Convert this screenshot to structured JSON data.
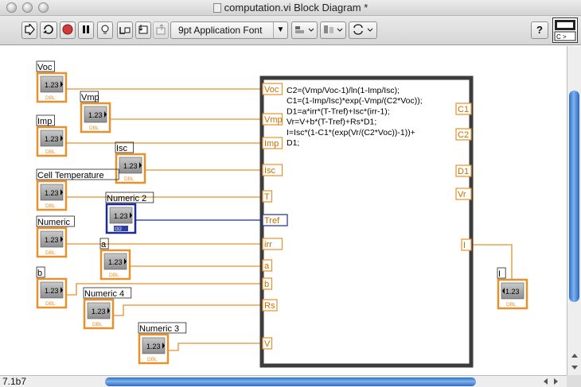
{
  "window": {
    "title": "computation.vi Block Diagram *"
  },
  "toolbar": {
    "font_select": "9pt Application Font",
    "run_icon": "run-arrow-icon",
    "help_label": "?"
  },
  "controls": [
    {
      "label": "Voc",
      "value": "1.23",
      "type": "DBL"
    },
    {
      "label": "Vmp",
      "value": "1.23",
      "type": "DBL"
    },
    {
      "label": "Imp",
      "value": "1.23",
      "type": "DBL"
    },
    {
      "label": "Isc",
      "value": "1.23",
      "type": "DBL"
    },
    {
      "label": "Cell Temperature",
      "value": "1.23",
      "type": "DBL"
    },
    {
      "label": "Numeric 2",
      "value": "1.23",
      "type": "I32"
    },
    {
      "label": "Numeric",
      "value": "1.23",
      "type": "DBL"
    },
    {
      "label": "a",
      "value": "1.23",
      "type": "DBL"
    },
    {
      "label": "b",
      "value": "1.23",
      "type": "DBL"
    },
    {
      "label": "Numeric 4",
      "value": "1.23",
      "type": "DBL"
    },
    {
      "label": "Numeric 3",
      "value": "1.23",
      "type": "DBL"
    }
  ],
  "formula_node": {
    "inputs": [
      "Voc",
      "Vmp",
      "Imp",
      "Isc",
      "T",
      "Tref",
      "irr",
      "a",
      "b",
      "Rs",
      "V"
    ],
    "outputs": [
      "C1",
      "C2",
      "D1",
      "Vr",
      "I"
    ],
    "code": [
      "C2=(Vmp/Voc-1)/ln(1-Imp/Isc);",
      "C1=(1-Imp/Isc)*exp(-Vmp/(C2*Voc));",
      "D1=a*irr*(T-Tref)+Isc*(irr-1);",
      "Vr=V+b*(T-Tref)+Rs*D1;",
      "I=Isc*(1-C1*(exp(Vr/(C2*Voc))-1))+",
      "D1;"
    ]
  },
  "indicator": {
    "label": "I",
    "value": "1.23",
    "type": "DBL"
  },
  "status": {
    "version": "7.1b7"
  },
  "colors": {
    "dbl_wire": "#e8902a",
    "int_wire": "#1f2a9a",
    "frame": "#3c3c3c"
  }
}
